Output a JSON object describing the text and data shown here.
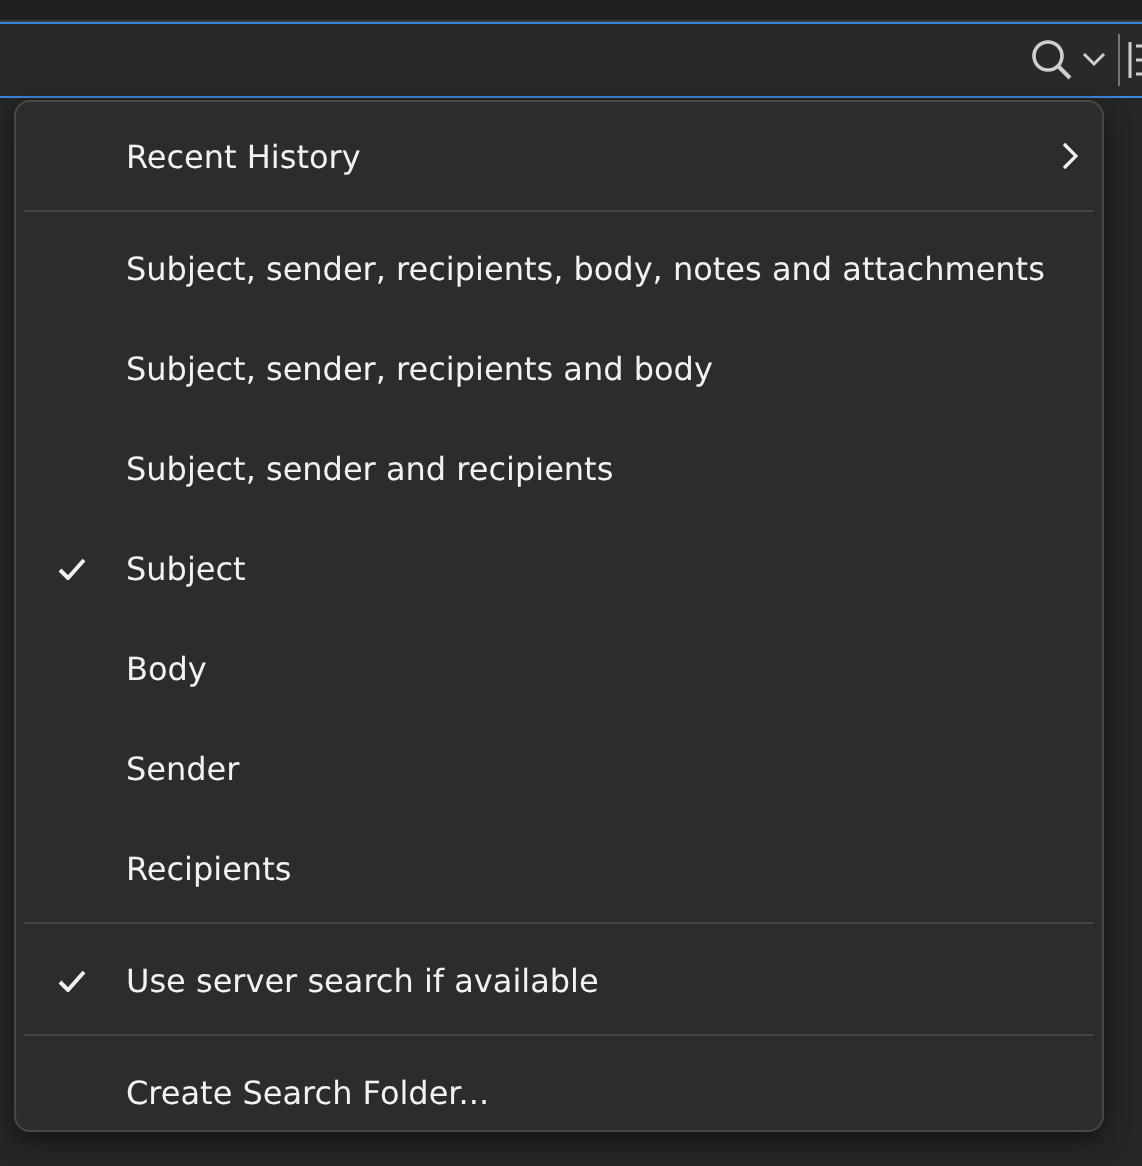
{
  "menu": {
    "items": [
      {
        "kind": "submenu",
        "label": "Recent History"
      },
      {
        "kind": "separator"
      },
      {
        "kind": "option",
        "label": "Subject, sender, recipients, body, notes and attachments",
        "checked": false
      },
      {
        "kind": "option",
        "label": "Subject, sender, recipients and body",
        "checked": false
      },
      {
        "kind": "option",
        "label": "Subject, sender and recipients",
        "checked": false
      },
      {
        "kind": "option",
        "label": "Subject",
        "checked": true
      },
      {
        "kind": "option",
        "label": "Body",
        "checked": false
      },
      {
        "kind": "option",
        "label": "Sender",
        "checked": false
      },
      {
        "kind": "option",
        "label": "Recipients",
        "checked": false
      },
      {
        "kind": "separator"
      },
      {
        "kind": "option",
        "label": "Use server search if available",
        "checked": true
      },
      {
        "kind": "separator"
      },
      {
        "kind": "action",
        "label": "Create Search Folder..."
      }
    ]
  }
}
